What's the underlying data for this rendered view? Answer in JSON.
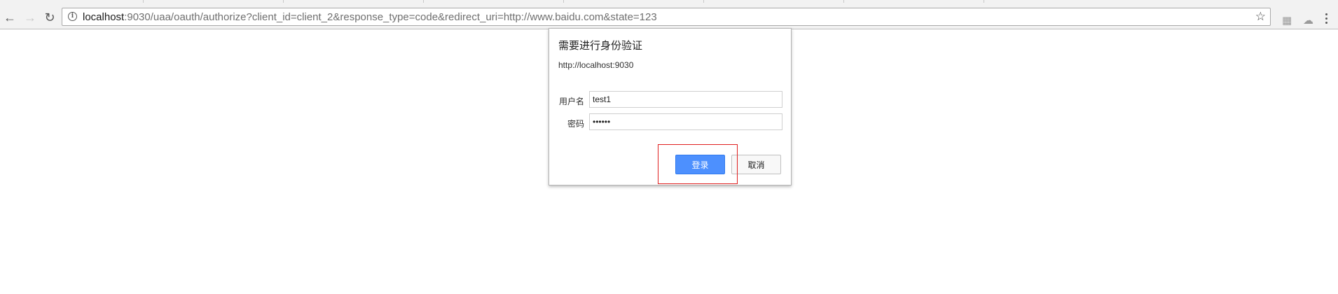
{
  "browser": {
    "url_host": "localhost",
    "url_rest": ":9030/uaa/oauth/authorize?client_id=client_2&response_type=code&redirect_uri=http://www.baidu.com&state=123",
    "back_icon": "arrow-left-icon",
    "forward_icon": "arrow-right-icon",
    "reload_icon": "reload-icon",
    "info_icon": "info-icon",
    "bookmark_icon": "star-icon",
    "menu_icon": "three-dots-icon"
  },
  "dialog": {
    "title": "需要进行身份验证",
    "origin": "http://localhost:9030",
    "username_label": "用户名",
    "username_value": "test1",
    "password_label": "密码",
    "password_value": "••••••",
    "login_label": "登录",
    "cancel_label": "取消"
  },
  "colors": {
    "login_button": "#4d90fe",
    "highlight_box": "#e02020"
  }
}
